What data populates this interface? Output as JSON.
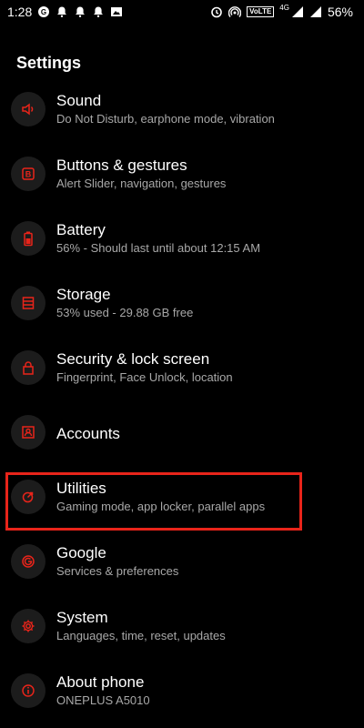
{
  "status_bar": {
    "time": "1:28",
    "network_type": "4G",
    "volte": "VoLTE",
    "battery": "56%"
  },
  "page": {
    "title": "Settings"
  },
  "accent_color": "#e8241a",
  "highlight_color": "#e8241a",
  "items": [
    {
      "label": "Sound",
      "sub": "Do Not Disturb, earphone mode, vibration",
      "icon": "speaker-icon"
    },
    {
      "label": "Buttons & gestures",
      "sub": "Alert Slider, navigation, gestures",
      "icon": "button-b-icon"
    },
    {
      "label": "Battery",
      "sub": "56% - Should last until about 12:15 AM",
      "icon": "battery-icon"
    },
    {
      "label": "Storage",
      "sub": "53% used - 29.88 GB free",
      "icon": "storage-icon"
    },
    {
      "label": "Security & lock screen",
      "sub": "Fingerprint, Face Unlock, location",
      "icon": "lock-icon"
    },
    {
      "label": "Accounts",
      "sub": "",
      "icon": "account-icon"
    },
    {
      "label": "Utilities",
      "sub": "Gaming mode, app locker, parallel apps",
      "icon": "utilities-icon"
    },
    {
      "label": "Google",
      "sub": "Services & preferences",
      "icon": "google-icon"
    },
    {
      "label": "System",
      "sub": "Languages, time, reset, updates",
      "icon": "gear-icon"
    },
    {
      "label": "About phone",
      "sub": "ONEPLUS A5010",
      "icon": "info-icon"
    }
  ]
}
